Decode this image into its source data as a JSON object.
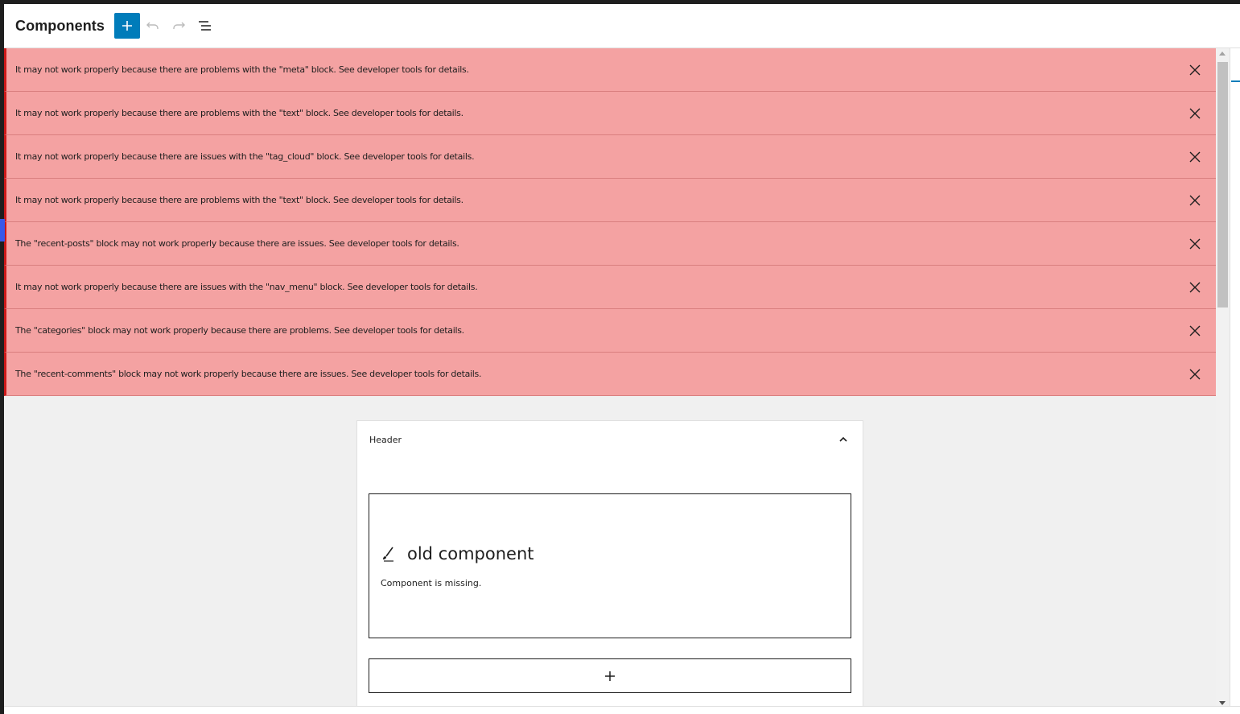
{
  "header": {
    "title": "Components",
    "add_label": "+",
    "undo_icon": "undo-icon",
    "redo_icon": "redo-icon",
    "outline_icon": "list-view-icon"
  },
  "notices": [
    {
      "text": "It may not work properly because there are problems with the \"meta\" block. See developer tools for details."
    },
    {
      "text": "It may not work properly because there are problems with the \"text\" block. See developer tools for details."
    },
    {
      "text": "It may not work properly because there are issues with the \"tag_cloud\" block. See developer tools for details."
    },
    {
      "text": "It may not work properly because there are problems with the \"text\" block. See developer tools for details."
    },
    {
      "text": "The \"recent-posts\" block may not work properly because there are issues. See developer tools for details."
    },
    {
      "text": "It may not work properly because there are issues with the \"nav_menu\" block. See developer tools for details."
    },
    {
      "text": "The \"categories\" block may not work properly because there are problems. See developer tools for details."
    },
    {
      "text": "The \"recent-comments\" block may not work properly because there are issues. See developer tools for details."
    }
  ],
  "area": {
    "label": "Header",
    "component_name": "old component",
    "component_message": "Component is missing.",
    "appender_label": "+"
  },
  "colors": {
    "accent": "#007cba",
    "notice_bg": "#f4a2a2",
    "notice_border": "#cc1818",
    "canvas_bg": "#f0f0f0"
  }
}
